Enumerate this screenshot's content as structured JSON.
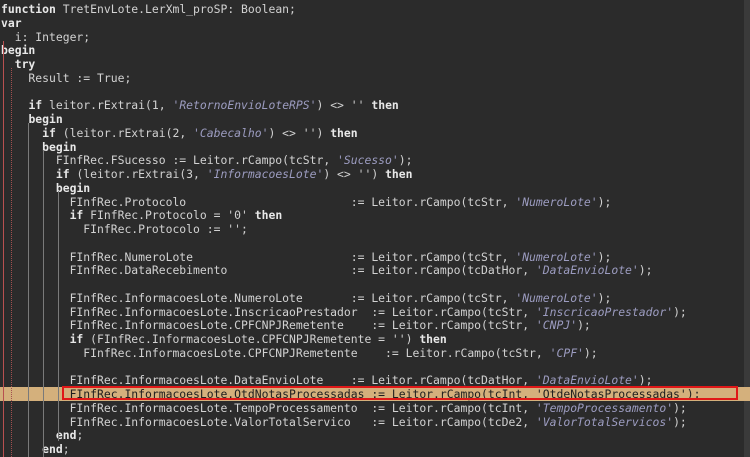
{
  "editor": {
    "language": "Delphi / Object Pascal",
    "highlighted_line": 28,
    "lines": [
      [
        [
          "kw",
          "function"
        ],
        [
          "txt",
          " TretEnvLote.LerXml_proSP: Boolean;"
        ]
      ],
      [
        [
          "kw",
          "var"
        ]
      ],
      [
        [
          "txt",
          "  i: Integer;"
        ]
      ],
      [
        [
          "kw",
          "begin"
        ]
      ],
      [
        [
          "txt",
          "  "
        ],
        [
          "kw",
          "try"
        ]
      ],
      [
        [
          "txt",
          "    Result := True;"
        ]
      ],
      [],
      [
        [
          "txt",
          "    "
        ],
        [
          "kw",
          "if"
        ],
        [
          "txt",
          " leitor.rExtrai(1, "
        ],
        [
          "str",
          "'RetornoEnvioLoteRPS'"
        ],
        [
          "txt",
          ") <> '' "
        ],
        [
          "kw",
          "then"
        ]
      ],
      [
        [
          "txt",
          "    "
        ],
        [
          "kw",
          "begin"
        ]
      ],
      [
        [
          "txt",
          "      "
        ],
        [
          "kw",
          "if"
        ],
        [
          "txt",
          " (leitor.rExtrai(2, "
        ],
        [
          "str",
          "'Cabecalho'"
        ],
        [
          "txt",
          ") <> '') "
        ],
        [
          "kw",
          "then"
        ]
      ],
      [
        [
          "txt",
          "      "
        ],
        [
          "kw",
          "begin"
        ]
      ],
      [
        [
          "txt",
          "        FInfRec.FSucesso := Leitor.rCampo(tcStr, "
        ],
        [
          "str",
          "'Sucesso'"
        ],
        [
          "txt",
          ");"
        ]
      ],
      [
        [
          "txt",
          "        "
        ],
        [
          "kw",
          "if"
        ],
        [
          "txt",
          " (leitor.rExtrai(3, "
        ],
        [
          "str",
          "'InformacoesLote'"
        ],
        [
          "txt",
          ") <> '') "
        ],
        [
          "kw",
          "then"
        ]
      ],
      [
        [
          "txt",
          "        "
        ],
        [
          "kw",
          "begin"
        ]
      ],
      [
        [
          "txt",
          "          FInfRec.Protocolo                        := Leitor.rCampo(tcStr, "
        ],
        [
          "str",
          "'NumeroLote'"
        ],
        [
          "txt",
          ");"
        ]
      ],
      [
        [
          "txt",
          "          "
        ],
        [
          "kw",
          "if"
        ],
        [
          "txt",
          " FInfRec.Protocolo = '0' "
        ],
        [
          "kw",
          "then"
        ]
      ],
      [
        [
          "txt",
          "            FInfRec.Protocolo := '';"
        ]
      ],
      [],
      [
        [
          "txt",
          "          FInfRec.NumeroLote                       := Leitor.rCampo(tcStr, "
        ],
        [
          "str",
          "'NumeroLote'"
        ],
        [
          "txt",
          ");"
        ]
      ],
      [
        [
          "txt",
          "          FInfRec.DataRecebimento                  := Leitor.rCampo(tcDatHor, "
        ],
        [
          "str",
          "'DataEnvioLote'"
        ],
        [
          "txt",
          ");"
        ]
      ],
      [],
      [
        [
          "txt",
          "          FInfRec.InformacoesLote.NumeroLote       := Leitor.rCampo(tcStr, "
        ],
        [
          "str",
          "'NumeroLote'"
        ],
        [
          "txt",
          ");"
        ]
      ],
      [
        [
          "txt",
          "          FInfRec.InformacoesLote.InscricaoPrestador  := Leitor.rCampo(tcStr, "
        ],
        [
          "str",
          "'InscricaoPrestador'"
        ],
        [
          "txt",
          ");"
        ]
      ],
      [
        [
          "txt",
          "          FInfRec.InformacoesLote.CPFCNPJRemetente    := Leitor.rCampo(tcStr, "
        ],
        [
          "str",
          "'CNPJ'"
        ],
        [
          "txt",
          ");"
        ]
      ],
      [
        [
          "txt",
          "          "
        ],
        [
          "kw",
          "if"
        ],
        [
          "txt",
          " (FInfRec.InformacoesLote.CPFCNPJRemetente = '') "
        ],
        [
          "kw",
          "then"
        ]
      ],
      [
        [
          "txt",
          "            FInfRec.InformacoesLote.CPFCNPJRemetente    := Leitor.rCampo(tcStr, "
        ],
        [
          "str",
          "'CPF'"
        ],
        [
          "txt",
          ");"
        ]
      ],
      [],
      [
        [
          "txt",
          "          FInfRec.InformacoesLote.DataEnvioLote    := Leitor.rCampo(tcDatHor, "
        ],
        [
          "str",
          "'DataEnvioLote'"
        ],
        [
          "txt",
          ");"
        ]
      ],
      [
        [
          "txt",
          "          FInfRec.InformacoesLote.QtdNotasProcessadas := Leitor.rCampo(tcInt, "
        ],
        [
          "str",
          "'QtdeNotasProcessadas'"
        ],
        [
          "txt",
          ");"
        ]
      ],
      [
        [
          "txt",
          "          FInfRec.InformacoesLote.TempoProcessamento  := Leitor.rCampo(tcInt, "
        ],
        [
          "str",
          "'TempoProcessamento'"
        ],
        [
          "txt",
          ");"
        ]
      ],
      [
        [
          "txt",
          "          FInfRec.InformacoesLote.ValorTotalServico   := Leitor.rCampo(tcDe2, "
        ],
        [
          "str",
          "'ValorTotalServicos'"
        ],
        [
          "txt",
          ");"
        ]
      ],
      [
        [
          "txt",
          "        "
        ],
        [
          "kw",
          "end"
        ],
        [
          "txt",
          ";"
        ]
      ],
      [
        [
          "txt",
          "      "
        ],
        [
          "kw",
          "end"
        ],
        [
          "txt",
          ";"
        ]
      ]
    ]
  }
}
